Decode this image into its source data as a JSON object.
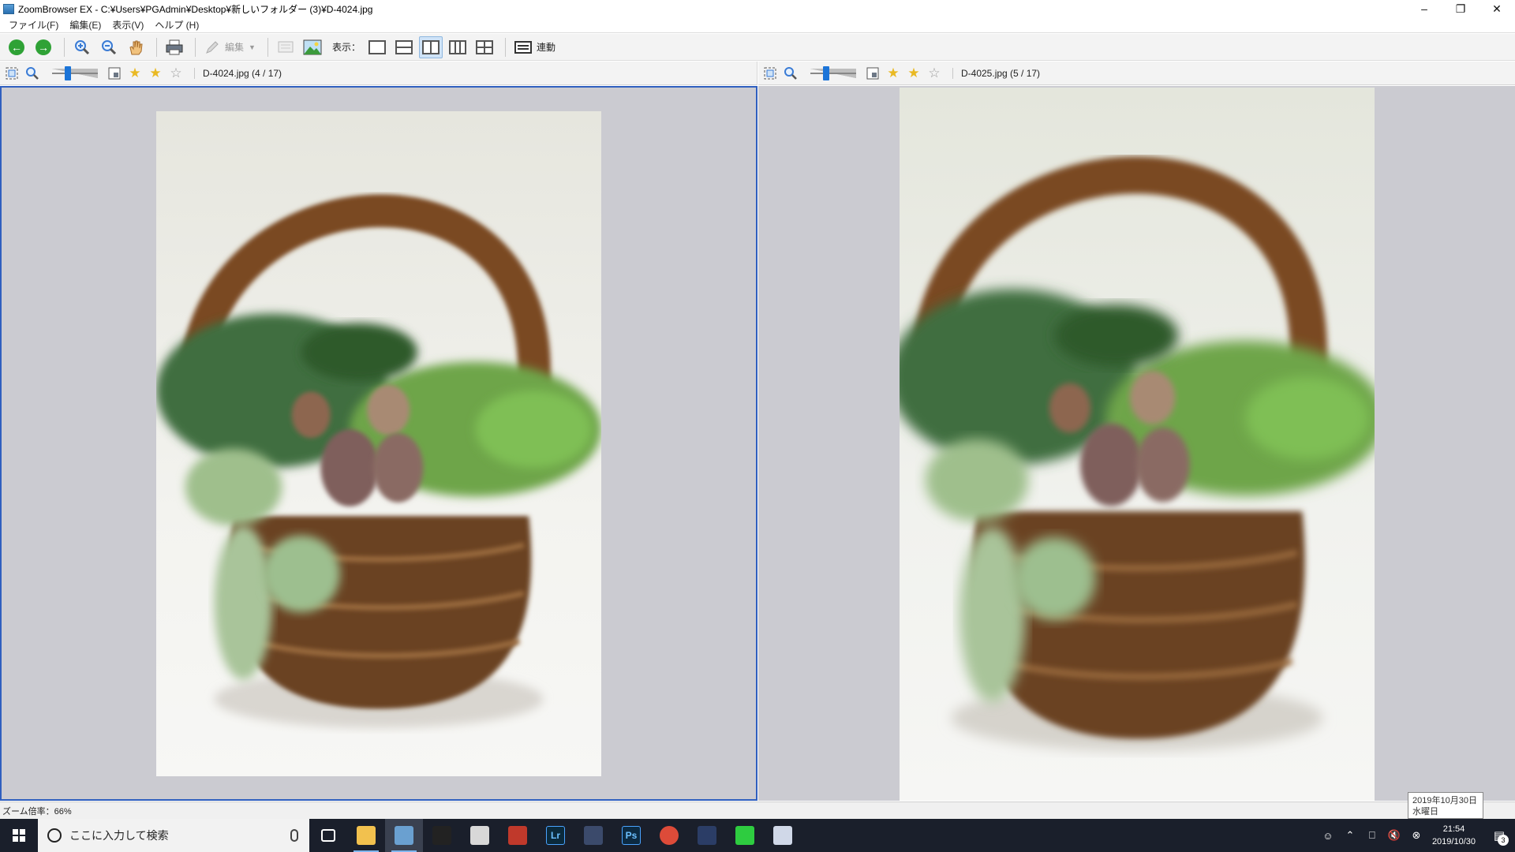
{
  "window": {
    "title": "ZoomBrowser EX - C:¥Users¥PGAdmin¥Desktop¥新しいフォルダー (3)¥D-4024.jpg"
  },
  "menu": [
    "ファイル(F)",
    "編集(E)",
    "表示(V)",
    "ヘルプ (H)"
  ],
  "toolbar": {
    "edit_label": "編集",
    "view_label": "表示：",
    "sync_label": "連動",
    "active_layout": "side-by-side"
  },
  "left_panel": {
    "filename": "D-4024.jpg (4 / 17)",
    "rating_filled": 2,
    "rating_total": 3,
    "selected": true
  },
  "right_panel": {
    "filename": "D-4025.jpg (5 / 17)",
    "rating_filled": 2,
    "rating_total": 3,
    "selected": false
  },
  "status": {
    "zoom_text": "ズーム倍率：66%"
  },
  "date_tooltip": {
    "date": "2019年10月30日",
    "weekday": "水曜日"
  },
  "taskbar": {
    "search_placeholder": "ここに入力して検索",
    "apps": [
      {
        "name": "task-view-icon",
        "color": "#1a1f2b"
      },
      {
        "name": "file-explorer-icon",
        "color": "#f2c14e"
      },
      {
        "name": "zoombrowser-icon",
        "color": "#6aa0d0"
      },
      {
        "name": "app-black-icon",
        "color": "#222222"
      },
      {
        "name": "app-notepad-icon",
        "color": "#d8d8d8"
      },
      {
        "name": "app-red-icon",
        "color": "#c0392b"
      },
      {
        "name": "lightroom-icon",
        "color": "#0b2a3c",
        "label": "Lr"
      },
      {
        "name": "app-diamond-icon",
        "color": "#3b4a6b"
      },
      {
        "name": "photoshop-icon",
        "color": "#0c2a42",
        "label": "Ps"
      },
      {
        "name": "chrome-icon",
        "color": "#dd4b39"
      },
      {
        "name": "app-blue-icon",
        "color": "#2b3d66"
      },
      {
        "name": "app-green-icon",
        "color": "#2ecc40"
      },
      {
        "name": "app-paint-icon",
        "color": "#d0d8e8"
      }
    ],
    "clock_time": "21:54",
    "clock_date": "2019/10/30",
    "notification_count": "3"
  },
  "colors": {
    "selection_border": "#2f5fbf",
    "viewer_background": "#cbcbd1",
    "star_filled": "#e9b923"
  }
}
